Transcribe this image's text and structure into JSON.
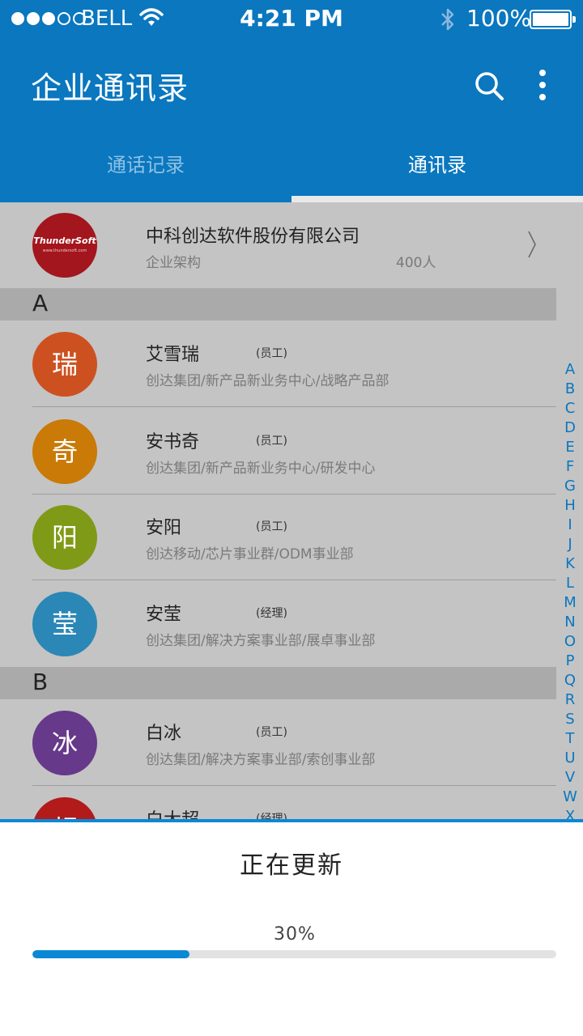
{
  "status_bar": {
    "carrier": "BELL",
    "time": "4:21 PM",
    "battery": "100%"
  },
  "header": {
    "title": "企业通讯录",
    "tabs": [
      {
        "label": "通话记录",
        "active": false
      },
      {
        "label": "通讯录",
        "active": true
      }
    ]
  },
  "org": {
    "logo_text": "ThunderSoft",
    "logo_sub": "www.thundersoft.com",
    "name": "中科创达软件股份有限公司",
    "subtitle": "企业架构",
    "count": "400人"
  },
  "sections": [
    {
      "letter": "A",
      "contacts": [
        {
          "avatar_char": "瑞",
          "avatar_color": "#cd5120",
          "name": "艾雪瑞",
          "role": "(员工)",
          "dept": "创达集团/新产品新业务中心/战略产品部"
        },
        {
          "avatar_char": "奇",
          "avatar_color": "#c97a07",
          "name": "安书奇",
          "role": "(员工)",
          "dept": "创达集团/新产品新业务中心/研发中心"
        },
        {
          "avatar_char": "阳",
          "avatar_color": "#7f9a16",
          "name": "安阳",
          "role": "(员工)",
          "dept": "创达移动/芯片事业群/ODM事业部"
        },
        {
          "avatar_char": "莹",
          "avatar_color": "#2b87b6",
          "name": "安莹",
          "role": "(经理)",
          "dept": "创达集团/解决方案事业部/展卓事业部"
        }
      ]
    },
    {
      "letter": "B",
      "contacts": [
        {
          "avatar_char": "冰",
          "avatar_color": "#67398a",
          "name": "白冰",
          "role": "(员工)",
          "dept": "创达集团/解决方案事业部/索创事业部"
        },
        {
          "avatar_char": "超",
          "avatar_color": "#b31a1a",
          "name": "白大超",
          "role": "(经理)",
          "dept": ""
        }
      ]
    }
  ],
  "index_letters": [
    "A",
    "B",
    "C",
    "D",
    "E",
    "F",
    "G",
    "H",
    "I",
    "J",
    "K",
    "L",
    "M",
    "N",
    "O",
    "P",
    "Q",
    "R",
    "S",
    "T",
    "U",
    "V",
    "W",
    "X"
  ],
  "update_sheet": {
    "title": "正在更新",
    "progress_label": "30%",
    "progress": 0.3,
    "accent_color": "#0a88d6"
  },
  "colors": {
    "header_bg": "#0a77bf",
    "list_bg": "#c4c4c4"
  }
}
